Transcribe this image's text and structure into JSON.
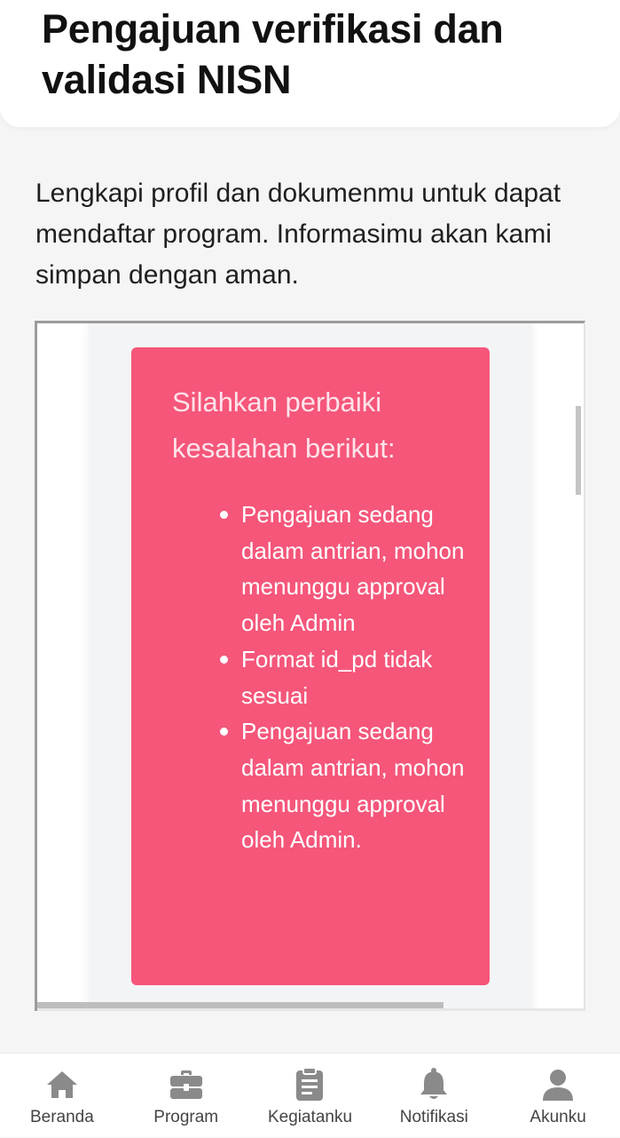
{
  "header": {
    "title": "Pengajuan verifikasi dan validasi NISN"
  },
  "intro": {
    "text": "Lengkapi profil dan dokumenmu untuk dapat mendaftar program. Informasimu akan kami simpan dengan aman."
  },
  "alert": {
    "title": "Silahkan perbaiki kesalahan berikut:",
    "items": [
      "Pengajuan sedang dalam antrian, mohon menunggu approval oleh Admin",
      "Format id_pd tidak sesuai",
      "Pengajuan sedang dalam antrian, mohon menunggu approval oleh Admin."
    ],
    "color": "#f5567a"
  },
  "nav": {
    "items": [
      {
        "label": "Beranda",
        "icon": "home-icon"
      },
      {
        "label": "Program",
        "icon": "briefcase-icon"
      },
      {
        "label": "Kegiatanku",
        "icon": "clipboard-icon"
      },
      {
        "label": "Notifikasi",
        "icon": "bell-icon"
      },
      {
        "label": "Akunku",
        "icon": "user-icon"
      }
    ],
    "icon_color": "#8a8a8a"
  }
}
